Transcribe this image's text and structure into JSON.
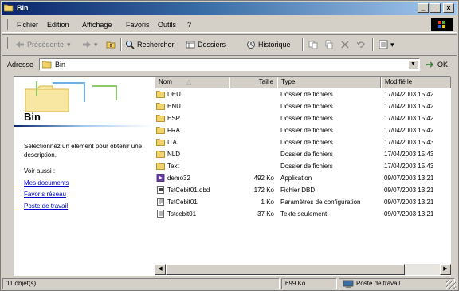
{
  "window": {
    "title": "Bin"
  },
  "titlebar_buttons": {
    "minimize": "_",
    "maximize": "□",
    "close": "×"
  },
  "menu": [
    "Fichier",
    "Edition",
    "Affichage",
    "Favoris",
    "Outils",
    "?"
  ],
  "toolbar": {
    "back": "Précédente",
    "search": "Rechercher",
    "folders": "Dossiers",
    "history": "Historique"
  },
  "address": {
    "label": "Adresse",
    "value": "Bin",
    "go": "OK"
  },
  "left_pane": {
    "title": "Bin",
    "description": "Sélectionnez un élément pour obtenir une description.",
    "see_also": "Voir aussi :",
    "links": [
      "Mes documents",
      "Favoris réseau",
      "Poste de travail"
    ]
  },
  "columns": {
    "name": "Nom",
    "size": "Taille",
    "type": "Type",
    "modified": "Modifié le"
  },
  "files": [
    {
      "name": "DEU",
      "size": "",
      "type": "Dossier de fichiers",
      "modified": "17/04/2003 15:42",
      "icon": "folder-icon"
    },
    {
      "name": "ENU",
      "size": "",
      "type": "Dossier de fichiers",
      "modified": "17/04/2003 15:42",
      "icon": "folder-icon"
    },
    {
      "name": "ESP",
      "size": "",
      "type": "Dossier de fichiers",
      "modified": "17/04/2003 15:42",
      "icon": "folder-icon"
    },
    {
      "name": "FRA",
      "size": "",
      "type": "Dossier de fichiers",
      "modified": "17/04/2003 15:42",
      "icon": "folder-icon"
    },
    {
      "name": "ITA",
      "size": "",
      "type": "Dossier de fichiers",
      "modified": "17/04/2003 15:43",
      "icon": "folder-icon"
    },
    {
      "name": "NLD",
      "size": "",
      "type": "Dossier de fichiers",
      "modified": "17/04/2003 15:43",
      "icon": "folder-icon"
    },
    {
      "name": "Text",
      "size": "",
      "type": "Dossier de fichiers",
      "modified": "17/04/2003 15:43",
      "icon": "folder-icon"
    },
    {
      "name": "demo32",
      "size": "492 Ko",
      "type": "Application",
      "modified": "09/07/2003 13:21",
      "icon": "application-icon"
    },
    {
      "name": "TstCebit01.dbd",
      "size": "172 Ko",
      "type": "Fichier DBD",
      "modified": "09/07/2003 13:21",
      "icon": "dbd-file-icon"
    },
    {
      "name": "TstCebit01",
      "size": "1 Ko",
      "type": "Paramètres de configuration",
      "modified": "09/07/2003 13:21",
      "icon": "config-file-icon"
    },
    {
      "name": "Tstcebit01",
      "size": "37 Ko",
      "type": "Texte seulement",
      "modified": "09/07/2003 13:21",
      "icon": "text-file-icon"
    }
  ],
  "status": {
    "count": "11 objet(s)",
    "size": "699 Ko",
    "zone": "Poste de travail"
  }
}
